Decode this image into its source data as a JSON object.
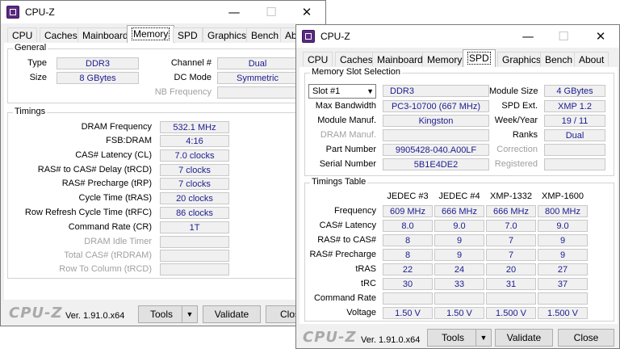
{
  "back_window": {
    "title": "CPU-Z",
    "tabs": [
      "CPU",
      "Caches",
      "Mainboard",
      "Memory",
      "SPD",
      "Graphics",
      "Bench",
      "Abo"
    ],
    "active_tab": "Memory",
    "general": {
      "label": "General",
      "type_label": "Type",
      "type_value": "DDR3",
      "size_label": "Size",
      "size_value": "8 GBytes",
      "channel_label": "Channel #",
      "channel_value": "Dual",
      "dcmode_label": "DC Mode",
      "dcmode_value": "Symmetric",
      "nbfreq_label": "NB Frequency",
      "nbfreq_value": ""
    },
    "timings": {
      "label": "Timings",
      "rows": [
        {
          "label": "DRAM Frequency",
          "value": "532.1 MHz",
          "enabled": true
        },
        {
          "label": "FSB:DRAM",
          "value": "4:16",
          "enabled": true
        },
        {
          "label": "CAS# Latency (CL)",
          "value": "7.0 clocks",
          "enabled": true
        },
        {
          "label": "RAS# to CAS# Delay (tRCD)",
          "value": "7 clocks",
          "enabled": true
        },
        {
          "label": "RAS# Precharge (tRP)",
          "value": "7 clocks",
          "enabled": true
        },
        {
          "label": "Cycle Time (tRAS)",
          "value": "20 clocks",
          "enabled": true
        },
        {
          "label": "Row Refresh Cycle Time (tRFC)",
          "value": "86 clocks",
          "enabled": true
        },
        {
          "label": "Command Rate (CR)",
          "value": "1T",
          "enabled": true
        },
        {
          "label": "DRAM Idle Timer",
          "value": "",
          "enabled": false
        },
        {
          "label": "Total CAS# (tRDRAM)",
          "value": "",
          "enabled": false
        },
        {
          "label": "Row To Column (tRCD)",
          "value": "",
          "enabled": false
        }
      ]
    },
    "footer": {
      "logo": "CPU-Z",
      "version": "Ver. 1.91.0.x64",
      "tools_label": "Tools",
      "validate_label": "Validate",
      "close_label": "Clos"
    }
  },
  "front_window": {
    "title": "CPU-Z",
    "tabs": [
      "CPU",
      "Caches",
      "Mainboard",
      "Memory",
      "SPD",
      "Graphics",
      "Bench",
      "About"
    ],
    "active_tab": "SPD",
    "slot": {
      "label": "Memory Slot Selection",
      "selected": "Slot #1",
      "type_value": "DDR3",
      "module_size_label": "Module Size",
      "module_size_value": "4 GBytes",
      "max_bw_label": "Max Bandwidth",
      "max_bw_value": "PC3-10700 (667 MHz)",
      "spd_ext_label": "SPD Ext.",
      "spd_ext_value": "XMP 1.2",
      "manuf_label": "Module Manuf.",
      "manuf_value": "Kingston",
      "week_year_label": "Week/Year",
      "week_year_value": "19 / 11",
      "dram_manuf_label": "DRAM Manuf.",
      "dram_manuf_value": "",
      "ranks_label": "Ranks",
      "ranks_value": "Dual",
      "part_label": "Part Number",
      "part_value": "9905428-040.A00LF",
      "correction_label": "Correction",
      "correction_value": "",
      "serial_label": "Serial Number",
      "serial_value": "5B1E4DE2",
      "registered_label": "Registered",
      "registered_value": ""
    },
    "timings_table": {
      "label": "Timings Table",
      "columns": [
        "JEDEC #3",
        "JEDEC #4",
        "XMP-1332",
        "XMP-1600"
      ],
      "rows": [
        {
          "label": "Frequency",
          "values": [
            "609 MHz",
            "666 MHz",
            "666 MHz",
            "800 MHz"
          ]
        },
        {
          "label": "CAS# Latency",
          "values": [
            "8.0",
            "9.0",
            "7.0",
            "9.0"
          ]
        },
        {
          "label": "RAS# to CAS#",
          "values": [
            "8",
            "9",
            "7",
            "9"
          ]
        },
        {
          "label": "RAS# Precharge",
          "values": [
            "8",
            "9",
            "7",
            "9"
          ]
        },
        {
          "label": "tRAS",
          "values": [
            "22",
            "24",
            "20",
            "27"
          ]
        },
        {
          "label": "tRC",
          "values": [
            "30",
            "33",
            "31",
            "37"
          ]
        },
        {
          "label": "Command Rate",
          "values": [
            "",
            "",
            "",
            ""
          ]
        },
        {
          "label": "Voltage",
          "values": [
            "1.50 V",
            "1.50 V",
            "1.500 V",
            "1.500 V"
          ]
        }
      ]
    },
    "footer": {
      "logo": "CPU-Z",
      "version": "Ver. 1.91.0.x64",
      "tools_label": "Tools",
      "validate_label": "Validate",
      "close_label": "Close"
    }
  }
}
